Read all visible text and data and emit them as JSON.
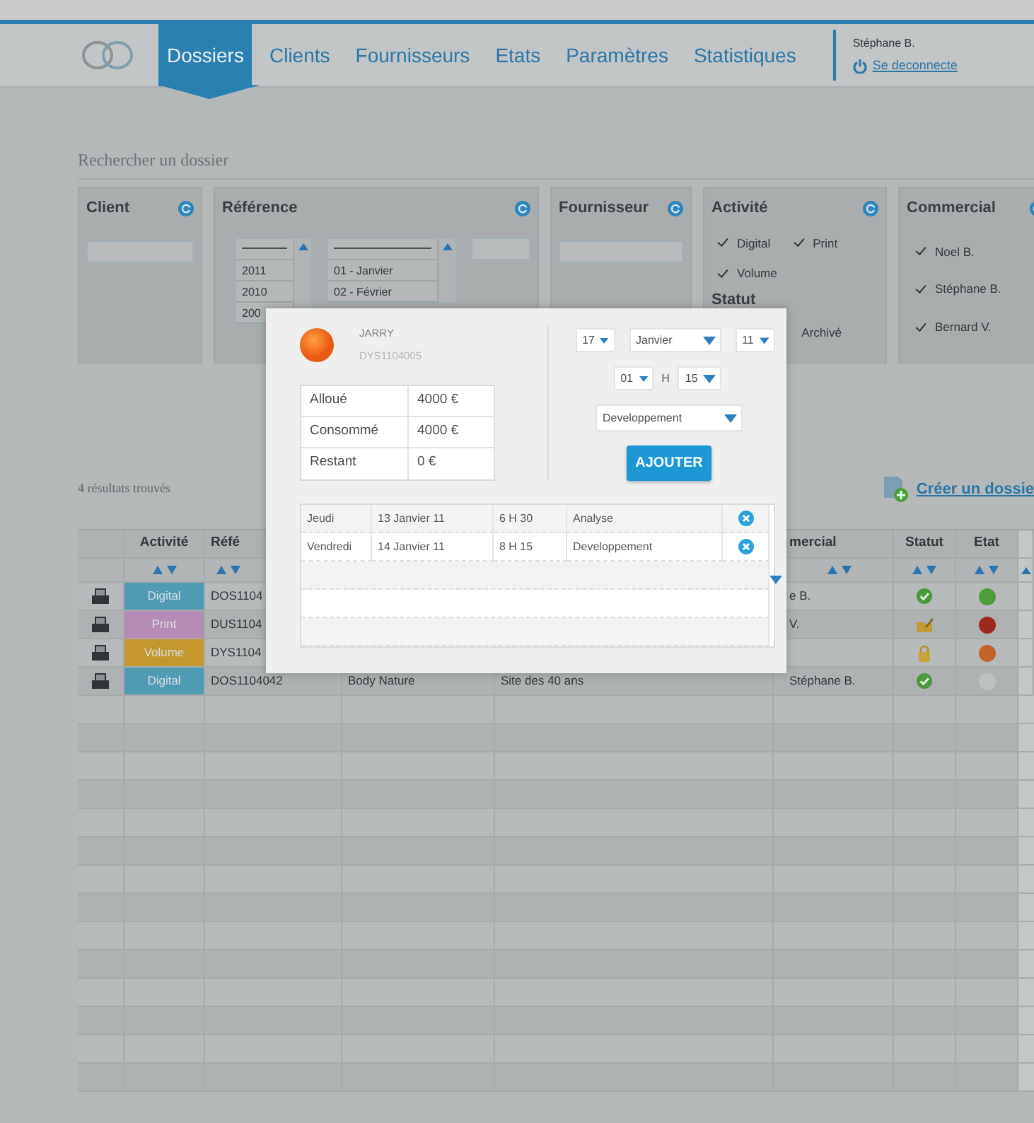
{
  "nav": {
    "tabs": [
      {
        "label": "Dossiers",
        "selected": true
      },
      {
        "label": "Clients",
        "selected": false
      },
      {
        "label": "Fournisseurs",
        "selected": false
      },
      {
        "label": "Etats",
        "selected": false
      },
      {
        "label": "Paramètres",
        "selected": false
      },
      {
        "label": "Statistiques",
        "selected": false
      }
    ],
    "user": "Stéphane B.",
    "logout": "Se deconnecte"
  },
  "search": {
    "title": "Rechercher un dossier",
    "panels": [
      {
        "kind": "text",
        "title": "Client"
      },
      {
        "kind": "reference",
        "title": "Référence",
        "years": [
          "2011",
          "2010",
          "200"
        ],
        "months": [
          "01 - Janvier",
          "02 - Février"
        ]
      },
      {
        "kind": "text",
        "title": "Fournisseur"
      },
      {
        "kind": "checks",
        "title": "Activité",
        "options": [
          {
            "label": "Digital",
            "checked": true
          },
          {
            "label": "Print",
            "checked": true
          },
          {
            "label": "Volume",
            "checked": true
          }
        ],
        "status_title": "Statut",
        "status_options": [
          "Archivé"
        ]
      },
      {
        "kind": "checks",
        "title": "Commercial",
        "options": [
          {
            "label": "Noel B.",
            "checked": true
          },
          {
            "label": "Stéphane B.",
            "checked": true
          },
          {
            "label": "Bernard V.",
            "checked": true
          }
        ]
      }
    ]
  },
  "results": {
    "count": "4 résultats trouvés",
    "create": "Créer un dossie"
  },
  "table": {
    "header": {
      "activity": "Activité",
      "reference": "Réfé",
      "commercial": "mercial",
      "status": "Statut",
      "state": "Etat"
    },
    "rows": [
      {
        "activity": {
          "label": "Digital",
          "color": "#4f9cb2"
        },
        "reference": "DOS1104",
        "commercial": "e B.",
        "status": {
          "kind": "valid"
        },
        "state": {
          "color": "#4f9e3a"
        }
      },
      {
        "activity": {
          "label": "Print",
          "color": "#b58db4"
        },
        "reference": "DUS1104",
        "commercial": "V.",
        "status": {
          "kind": "edit"
        },
        "state": {
          "color": "#9e2a1e"
        }
      },
      {
        "activity": {
          "label": "Volume",
          "color": "#c6962f"
        },
        "reference": "DYS1104",
        "status": {
          "kind": "locked"
        },
        "state": {
          "color": "#c4622c"
        }
      },
      {
        "activity": {
          "label": "Digital",
          "color": "#4f9cb2"
        },
        "reference": "DOS1104042",
        "column_4": "Body Nature",
        "column_5": "Site des 40 ans",
        "commercial": "Stéphane B.",
        "status": {
          "kind": "valid"
        },
        "state": {
          "color": "#bdbfc0"
        }
      }
    ]
  },
  "modal": {
    "client": "JARRY",
    "reference": "DYS1104005",
    "budget": [
      {
        "label": "Alloué",
        "value": "4000 €"
      },
      {
        "label": "Consommé",
        "value": "4000 €"
      },
      {
        "label": "Restant",
        "value": "0 €"
      }
    ],
    "date": {
      "day": "17",
      "month": "Janvier",
      "year": "11"
    },
    "time": {
      "hour": "01",
      "separator": "H",
      "minute": "15"
    },
    "activity": "Developpement",
    "add_button": "AJOUTER",
    "entries": [
      {
        "day": "Jeudi",
        "date": "13 Janvier 11",
        "time": "6 H 30",
        "activity": "Analyse"
      },
      {
        "day": "Vendredi",
        "date": "14 Janvier 11",
        "time": "8 H 15",
        "activity": "Developpement"
      }
    ]
  }
}
